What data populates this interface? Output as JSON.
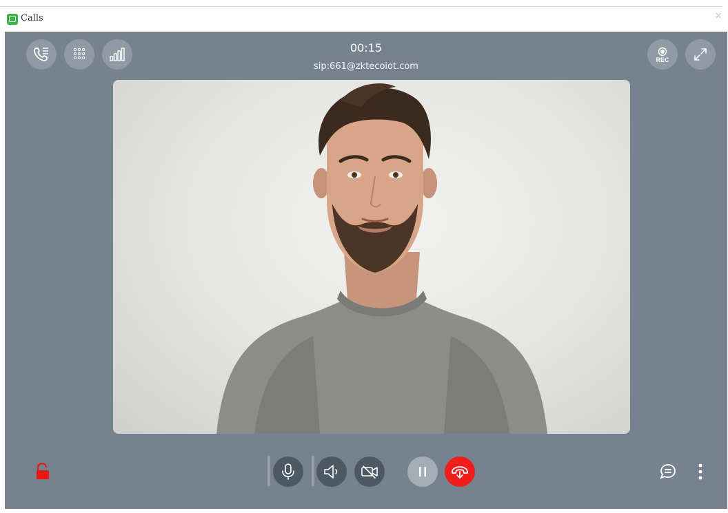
{
  "window": {
    "title": "Calls",
    "close_glyph": "×"
  },
  "call": {
    "timer": "00:15",
    "address": "sip:661@zktecoiot.com"
  },
  "icons": {
    "top_left": [
      "call-list-icon",
      "dialpad-icon",
      "signal-bars-icon"
    ],
    "top_right": [
      "record-icon",
      "fullscreen-icon"
    ],
    "bottom": [
      "unlock-icon",
      "microphone-icon",
      "speaker-icon",
      "camera-off-icon",
      "pause-icon",
      "hangup-icon",
      "chat-icon",
      "more-vertical-icon"
    ]
  },
  "record": {
    "label": "REC"
  },
  "colors": {
    "background": "#76838e",
    "hangup": "#f01d1d",
    "lock": "#e81818",
    "app_icon": "#3bb24a"
  }
}
